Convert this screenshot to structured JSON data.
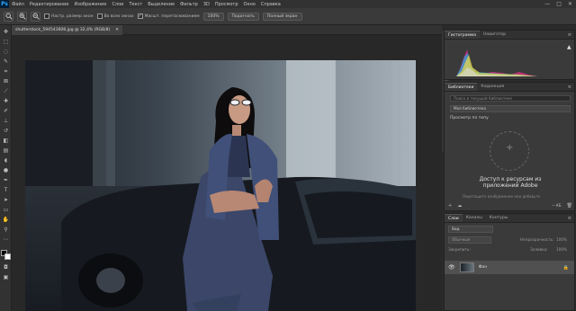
{
  "app": {
    "logo": "Ps"
  },
  "menu": [
    "Файл",
    "Редактирование",
    "Изображение",
    "Слои",
    "Текст",
    "Выделение",
    "Фильтр",
    "3D",
    "Просмотр",
    "Окно",
    "Справка"
  ],
  "window_controls": {
    "minimize": "—",
    "maximize": "□",
    "close": "✕"
  },
  "options_bar": {
    "resize_windows": "Настр. размер окон",
    "all_windows": "Во всех окнах",
    "scrubby_zoom": "Масшт. перетаскиванием",
    "zoom_100": "100%",
    "fit": "Подогнать",
    "fill_screen": "Полный экран"
  },
  "document_tab": {
    "title": "shutterstock_594543608.jpg @ 32,4% (RGB/8)",
    "close": "✕"
  },
  "histogram_panel": {
    "tabs": [
      "Гистограмма",
      "Навигатор"
    ],
    "warning_icon": "▲"
  },
  "libraries_panel": {
    "tabs": [
      "Библиотеки",
      "Коррекция"
    ],
    "search_placeholder": "Поиск в текущей библиотеке",
    "library_name": "Моя библиотека",
    "view_by": "Просмотр по типу",
    "access_title": "Доступ к ресурсам из приложений Adobe",
    "hint": "Перетащите изображение или добавьте",
    "size": "— КБ"
  },
  "layers_panel": {
    "tabs": [
      "Слои",
      "Каналы",
      "Контуры"
    ],
    "search": "Вид",
    "blend_mode": "Обычные",
    "opacity_label": "Непрозрачность:",
    "opacity": "100%",
    "lock_label": "Закрепить:",
    "fill_label": "Заливка:",
    "fill": "100%",
    "layer_name": "Фон"
  }
}
